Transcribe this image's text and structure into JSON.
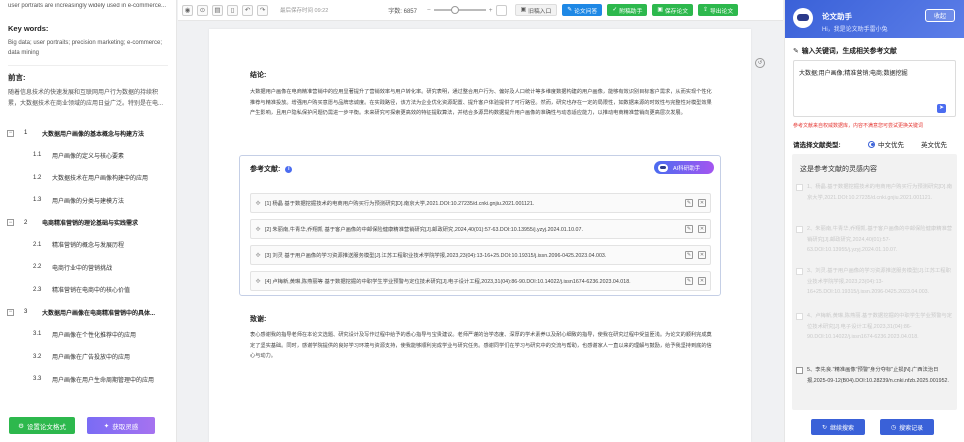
{
  "left": {
    "top_lines": [
      "user portraits are increasingly widely used in e-commerce..."
    ],
    "keywords_title": "Key words:",
    "keywords_text": "Big data; user portraits; precision marketing; e-commerce; data mining",
    "preface_title": "前言:",
    "preface_text": "随着信息技术的快速发展和互联网用户行为数据的持续积累，大数据技术在商业领域的应用日益广泛。特别是在电...",
    "outline": [
      {
        "num": "1",
        "title": "大数据用户画像的基本概念与构建方法",
        "subs": [
          {
            "num": "1.1",
            "title": "用户画像的定义与核心要素"
          },
          {
            "num": "1.2",
            "title": "大数据技术在用户画像构建中的应用"
          },
          {
            "num": "1.3",
            "title": "用户画像的分类与建模方法"
          }
        ]
      },
      {
        "num": "2",
        "title": "电商精准营销的理论基础与实践需求",
        "subs": [
          {
            "num": "2.1",
            "title": "精准营销的概念与发展历程"
          },
          {
            "num": "2.2",
            "title": "电商行业中的营销挑战"
          },
          {
            "num": "2.3",
            "title": "精准营销在电商中的核心价值"
          }
        ]
      },
      {
        "num": "3",
        "title": "大数据用户画像在电商精准营销中的具体...",
        "subs": [
          {
            "num": "3.1",
            "title": "用户画像在个性化推荐中的应用"
          },
          {
            "num": "3.2",
            "title": "用户画像在广告投放中的应用"
          },
          {
            "num": "3.3",
            "title": "用户画像在用户生命周期管理中的应用"
          }
        ]
      }
    ],
    "btn_format": "设置论文格式",
    "btn_inspire": "获取灵感"
  },
  "toolbar": {
    "save_status": "最后保存时间 09:22",
    "word_count": "字数: 6857",
    "zoom_level": 0.4,
    "btn_import": "旧稿入口",
    "btn_qa": "论文问答",
    "btn_check": "附稿助手",
    "btn_save": "保存论文",
    "btn_export": "导出论文"
  },
  "doc": {
    "conclusion_title": "结论:",
    "conclusion_text": "大数据用户画像在电商精准营销中的应用显著提升了营销效率与用户转化率。研究表明，通过整合用户行为、偏好及人口统计等多维度数据构建的用户画像，能够有效识别目标客户需求，从而实现个性化推荐与精准投放。增强用户购买意愿与品牌忠诚度。在实践路径，该方法为企业优化资源配置、提升客户体验提供了可行路径。然而，研究也存在一定的局限性，如数据来源的时效性与完整性对模型效果产生影响，且用户隐私保护问题仍需进一步平衡。未来研究可探索更高效的特征提取算法，并结合多源异构数据提升用户画像的准确性与动态适应能力，以推动电商精准营销向更高层次发展。",
    "ref_title": "参考文献:",
    "ai_btn": "AI科研助手",
    "refs": [
      "[1] 杨晶 基于数据挖掘技术的电商用户购买行为预测研究[D].南京大学,2021.DOI:10.27235/d.cnki.gnjiu.2021.001121.",
      "[2] 朱丽南,牛青华,乔翔凯 基于客户画像的中邮保险健康精准营销研究[J].邮政研究,2024,40(01):57-63.DOI:10.13955/j.yzyj.2024.01.10.07.",
      "[3] 刘灵 基于用户画像的学习资源推送服务模型[J].江苏工程职业技术学院学报,2023,23(04):13-16+25.DOI:10.19315/j.issn.2096-0425.2023.04.003.",
      "[4] 卢梅新,黄琳,陈燕丽等 基于数据挖掘的中职学生学业预警与定位技术研究[J].电子设计工程,2023,31(04):86-90.DOI:10.14022/j.issn1674-6236.2023.04.018."
    ],
    "thanks_title": "致谢:",
    "thanks_text": "衷心感谢我的指导老师在本论文选题、研究设计及写作过程中给予的悉心指导与宝贵建议。老师严谨的治学态度、深厚的学术素养以及耐心细致的指导，使我在研究过程中受益匪浅。为论文的顺利完成奠定了坚实基础。同时，感谢学院提供的良好学习环境与资源支持，使我能够顺利完成学业与研究任务。感谢同学们在学习与研究中的交流与帮助，也感谢家人一直以来的理解与鼓励，给予我坚持到底的信心与动力。"
  },
  "assistant": {
    "title": "论文助手",
    "greeting": "Hi，我是论文助手雷小兔",
    "collapse": "收起",
    "input_label": "输入关键词，生成相关参考文献",
    "input_value": "大数据;用户画像;精准营销;电商;数据挖掘",
    "warning": "参考文献来自权威数据库，内容不满意您可尝试更换关键词",
    "type_label": "请选择文献类型:",
    "opt_cn": "中文优先",
    "opt_en": "英文优先",
    "list_title": "这是参考文献的灵感内容",
    "suggestions": [
      "1、杨晶.基于数据挖掘技术的电商用户购买行为预测研究[D].南京大学,2021.DOI:10.27235/d.cnki.gnjiu.2021.001121.",
      "2、朱丽南,牛青华,乔翔凯.基于客户画像的中邮保险健康精准营销研究[J].邮政研究,2024,40(01):57-63.DOI:10.13955/j.yzyj.2024.01.10.07.",
      "3、刘灵.基于用户画像的学习资源推送服务模型[J].江苏工程职业技术学院学报,2023,23(04):13-16+25.DOI:10.19315/j.issn.2096-0425.2023.04.003.",
      "4、卢梅新,黄琳,陈燕丽.基于数据挖掘的中职学生学业预警与定位技术研究[J].电子设计工程,2023,31(04):86-90.DOI:10.14022/j.issn1674-6236.2023.04.018.",
      "5、李先良.\"精准画像\"预警\"身分夺标\"止损[N].广西法治日报,2025-09-12(B04).DOI:10.28239/n.cnki.nfzb.2025.001952."
    ],
    "btn_continue": "继续搜索",
    "btn_history": "搜索记录"
  },
  "colors": {
    "primary": "#3a61d8",
    "green": "#2db84d",
    "warn": "#e53935"
  }
}
